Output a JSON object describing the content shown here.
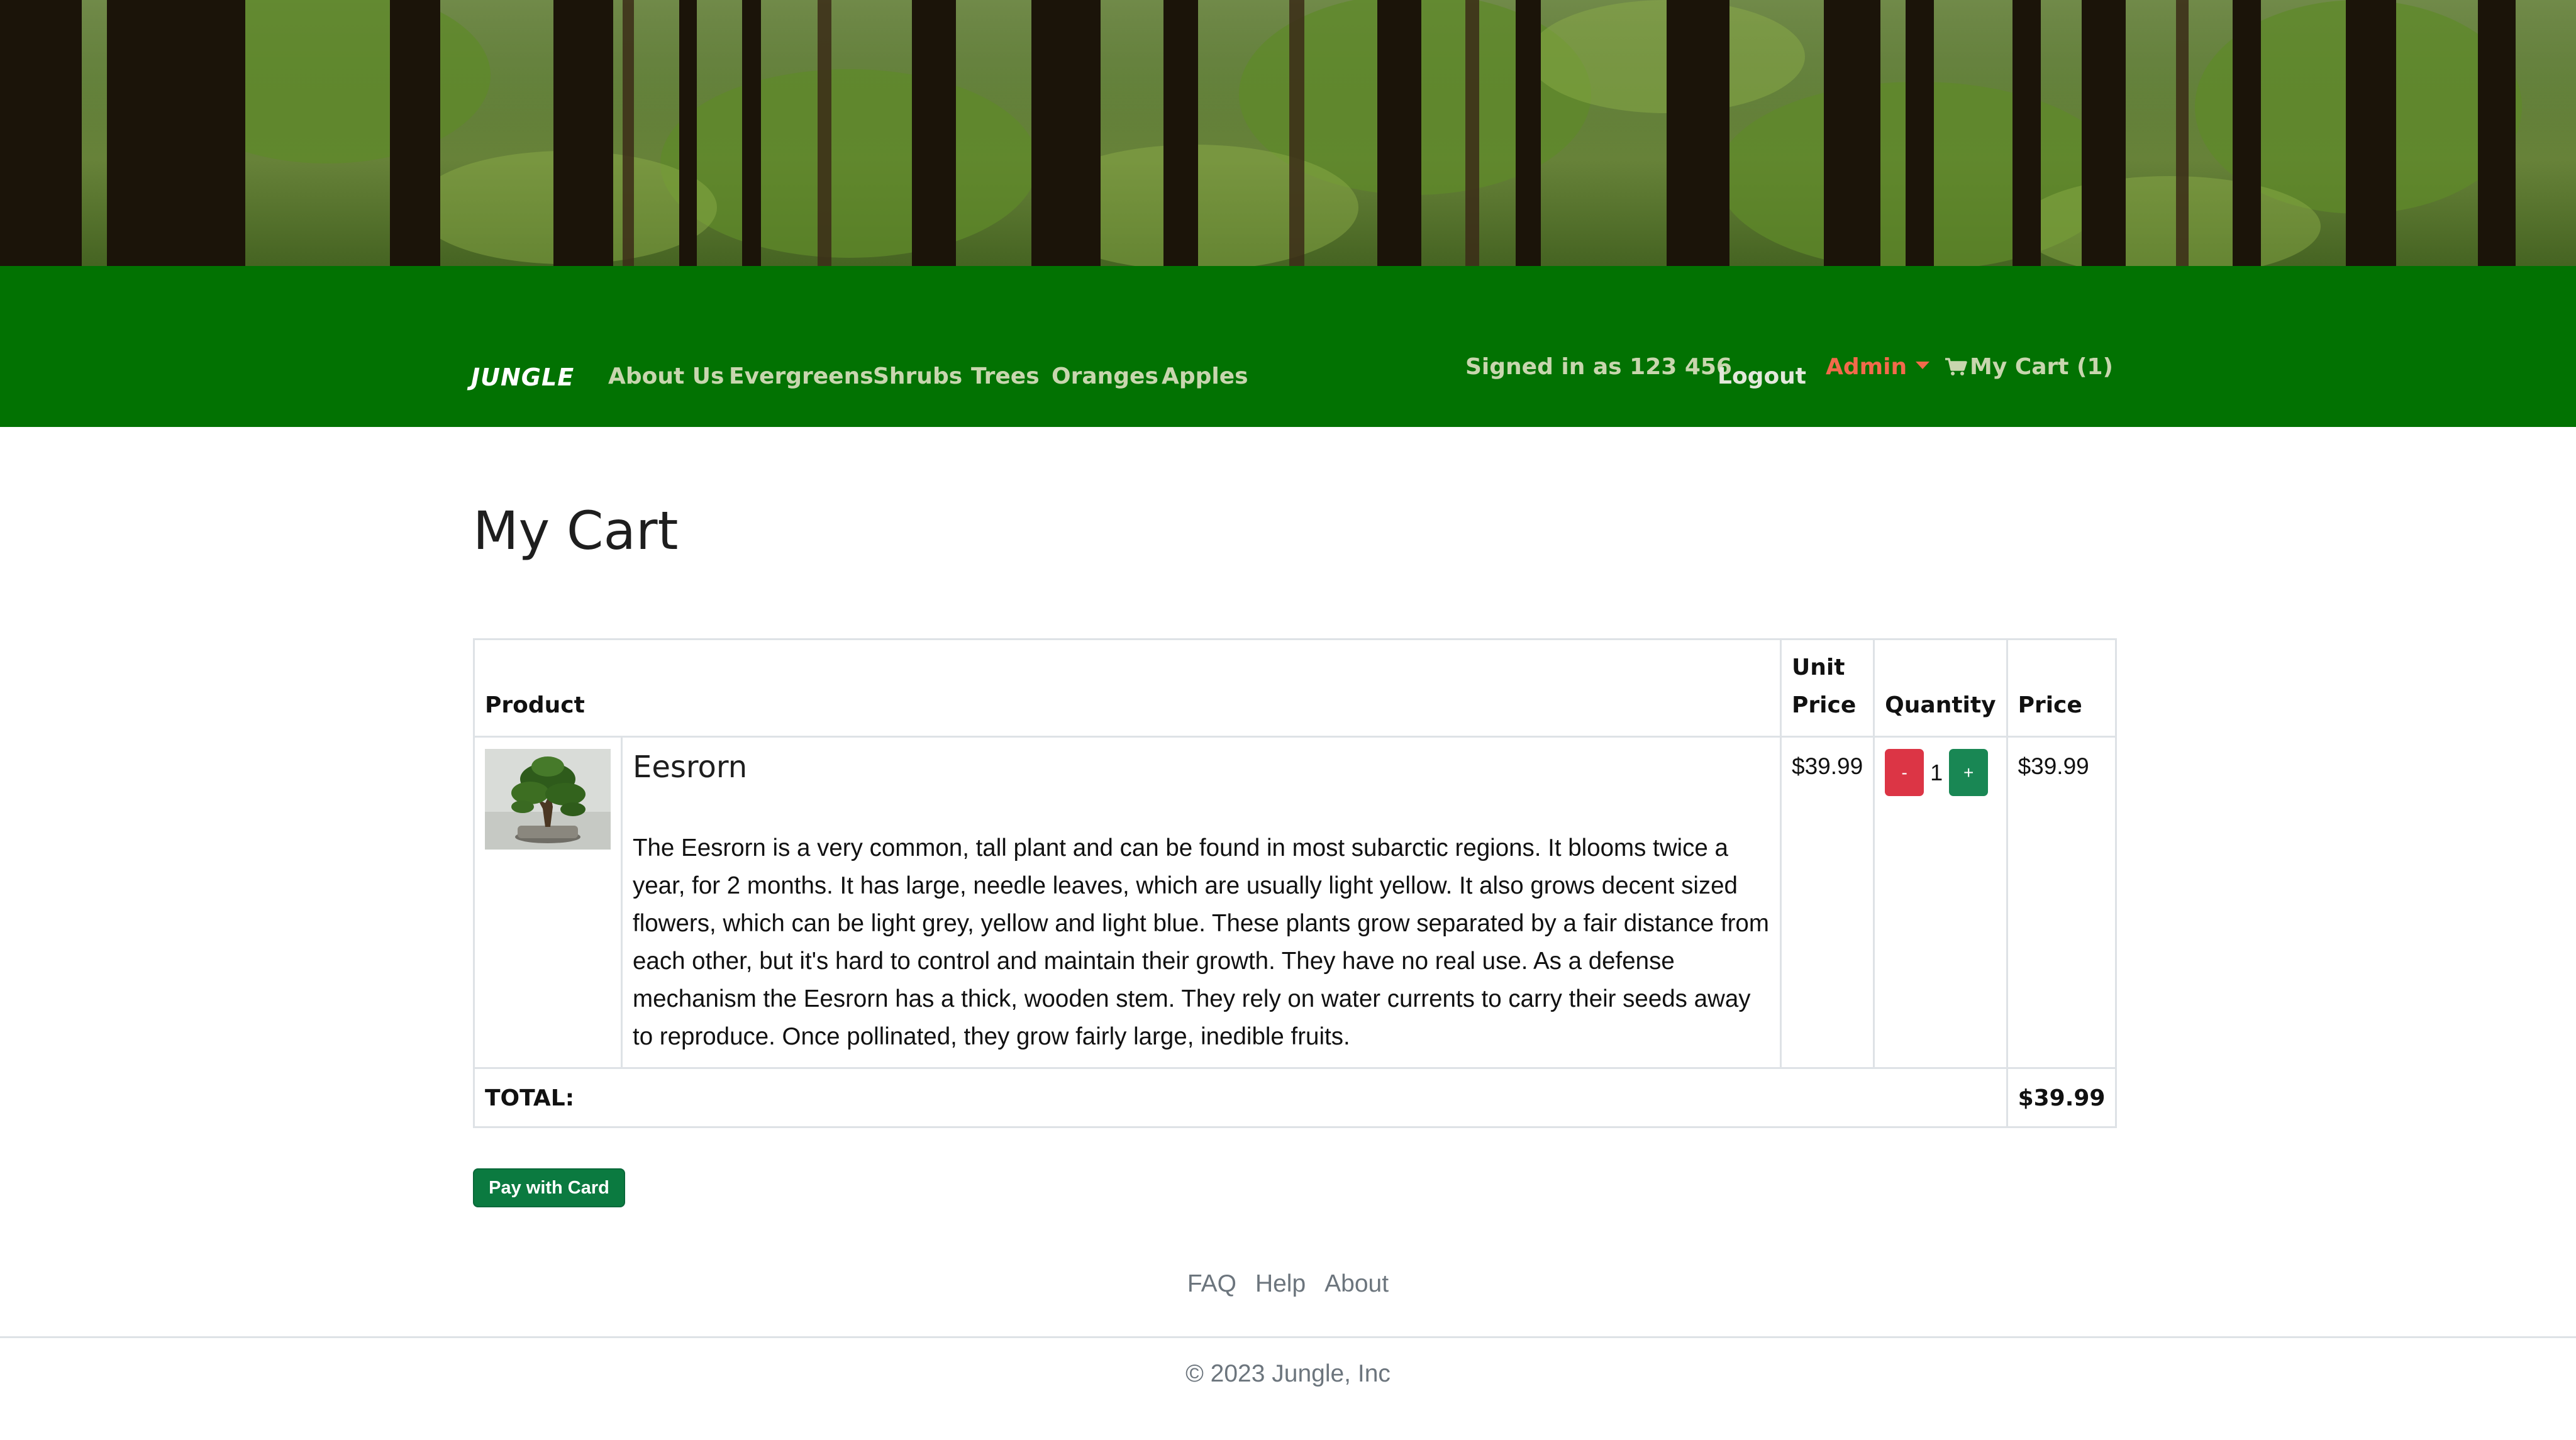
{
  "nav": {
    "brand": "JUNGLE",
    "links": [
      "About Us",
      "Evergreens",
      "Shrubs",
      "Trees",
      "Oranges",
      "Apples"
    ],
    "signed_in": "Signed in as 123 456",
    "logout": "Logout",
    "admin": "Admin",
    "cart": "My Cart (1)"
  },
  "page": {
    "title": "My Cart"
  },
  "table": {
    "headers": {
      "product": "Product",
      "unit_price": "Unit Price",
      "quantity": "Quantity",
      "price": "Price"
    },
    "items": [
      {
        "name": "Eesrorn",
        "description": "The Eesrorn is a very common, tall plant and can be found in most subarctic regions. It blooms twice a year, for 2 months. It has large, needle leaves, which are usually light yellow. It also grows decent sized flowers, which can be light grey, yellow and light blue. These plants grow separated by a fair distance from each other, but it's hard to control and maintain their growth. They have no real use. As a defense mechanism the Eesrorn has a thick, wooden stem. They rely on water currents to carry their seeds away to reproduce. Once pollinated, they grow fairly large, inedible fruits.",
        "unit_price": "$39.99",
        "quantity": "1",
        "minus": "-",
        "plus": "+",
        "price": "$39.99"
      }
    ],
    "total_label": "TOTAL:",
    "total_value": "$39.99"
  },
  "pay_button": "Pay with Card",
  "footer": {
    "links": [
      "FAQ",
      "Help",
      "About"
    ],
    "copyright": "© 2023 Jungle, Inc"
  },
  "colors": {
    "navbar": "#027202",
    "admin": "#f26a4b",
    "minus_button": "#dc3545",
    "plus_button": "#198754",
    "pay_button": "#0b7a40"
  }
}
